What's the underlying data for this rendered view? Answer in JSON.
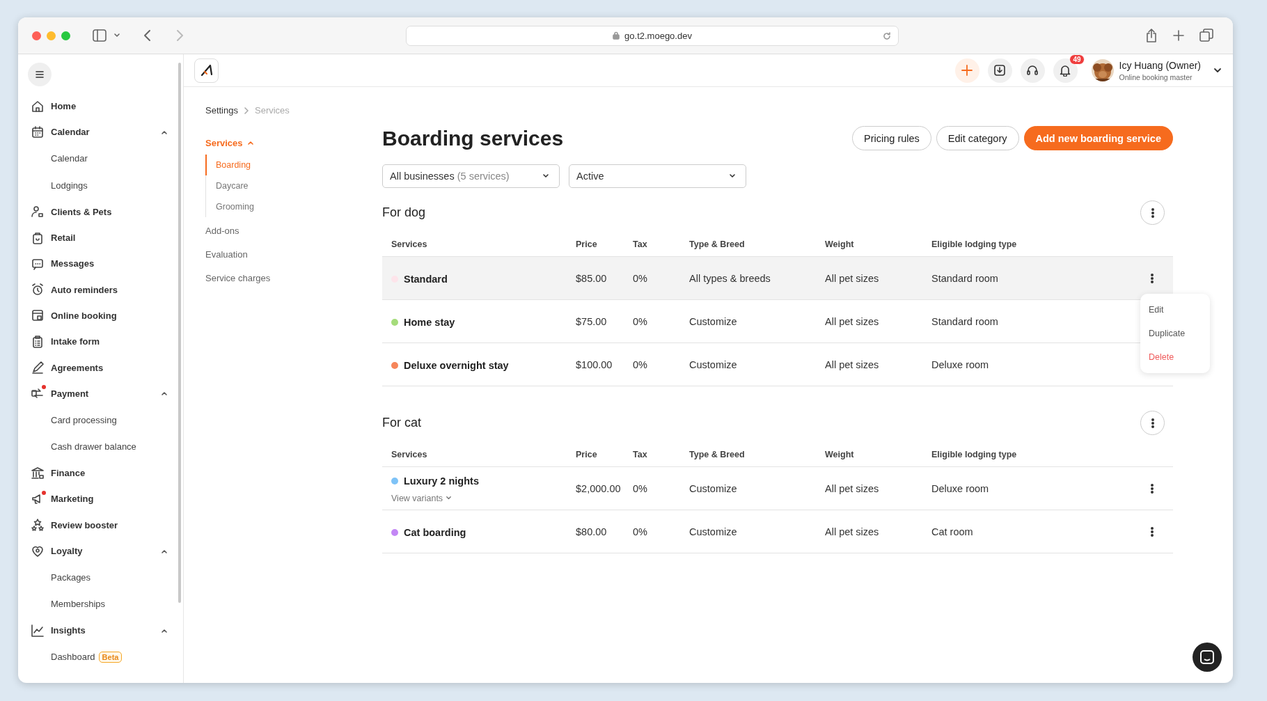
{
  "browser": {
    "url": "go.t2.moego.dev"
  },
  "sidebar": {
    "items": [
      {
        "label": "Home",
        "dot": false
      },
      {
        "label": "Calendar",
        "dot": false,
        "expanded": true,
        "children": [
          {
            "label": "Calendar"
          },
          {
            "label": "Lodgings"
          }
        ]
      },
      {
        "label": "Clients & Pets",
        "dot": false
      },
      {
        "label": "Retail",
        "dot": false
      },
      {
        "label": "Messages",
        "dot": false
      },
      {
        "label": "Auto reminders",
        "dot": false
      },
      {
        "label": "Online booking",
        "dot": false
      },
      {
        "label": "Intake form",
        "dot": false
      },
      {
        "label": "Agreements",
        "dot": false
      },
      {
        "label": "Payment",
        "dot": true,
        "expanded": true,
        "children": [
          {
            "label": "Card processing"
          },
          {
            "label": "Cash drawer balance"
          }
        ]
      },
      {
        "label": "Finance",
        "dot": false
      },
      {
        "label": "Marketing",
        "dot": true
      },
      {
        "label": "Review booster",
        "dot": false
      },
      {
        "label": "Loyalty",
        "dot": false,
        "expanded": true,
        "children": [
          {
            "label": "Packages"
          },
          {
            "label": "Memberships"
          }
        ]
      },
      {
        "label": "Insights",
        "dot": false,
        "expanded": true,
        "children": [
          {
            "label": "Dashboard",
            "badge": "Beta"
          }
        ]
      }
    ]
  },
  "header": {
    "notification_count": "49",
    "user_name": "Icy Huang (Owner)",
    "user_role": "Online booking master"
  },
  "breadcrumb": [
    "Settings",
    "Services"
  ],
  "settings_nav": [
    {
      "label": "Services",
      "selected": true,
      "expanded": true,
      "children": [
        {
          "label": "Boarding",
          "selected": true
        },
        {
          "label": "Daycare",
          "selected": false
        },
        {
          "label": "Grooming",
          "selected": false
        }
      ]
    },
    {
      "label": "Add-ons",
      "selected": false
    },
    {
      "label": "Evaluation",
      "selected": false
    },
    {
      "label": "Service charges",
      "selected": false
    }
  ],
  "page": {
    "title": "Boarding services",
    "buttons": [
      {
        "label": "Pricing rules",
        "kind": "outline"
      },
      {
        "label": "Edit category",
        "kind": "outline"
      },
      {
        "label": "Add new boarding service",
        "kind": "primary"
      }
    ],
    "filters": [
      {
        "value": "All businesses",
        "hint": "(5 services)"
      },
      {
        "value": "Active"
      }
    ]
  },
  "groups": [
    {
      "title": "For dog",
      "columns": [
        "Services",
        "Price",
        "Tax",
        "Type & Breed",
        "Weight",
        "Eligible lodging type"
      ],
      "rows": [
        {
          "name": "Standard",
          "color": "#fde4ea",
          "price": "$85.00",
          "tax": "0%",
          "type": "All types & breeds",
          "weight": "All pet sizes",
          "lodging": "Standard room",
          "highlighted": true,
          "menu": [
            {
              "label": "Edit",
              "kind": "normal"
            },
            {
              "label": "Duplicate",
              "kind": "normal"
            },
            {
              "label": "Delete",
              "kind": "danger"
            }
          ]
        },
        {
          "name": "Home stay",
          "color": "#a5dc7b",
          "price": "$75.00",
          "tax": "0%",
          "type": "Customize",
          "weight": "All pet sizes",
          "lodging": "Standard room",
          "highlighted": false
        },
        {
          "name": "Deluxe overnight stay",
          "color": "#f6855a",
          "price": "$100.00",
          "tax": "0%",
          "type": "Customize",
          "weight": "All pet sizes",
          "lodging": "Deluxe room",
          "highlighted": false
        }
      ]
    },
    {
      "title": "For cat",
      "columns": [
        "Services",
        "Price",
        "Tax",
        "Type & Breed",
        "Weight",
        "Eligible lodging type"
      ],
      "rows": [
        {
          "name": "Luxury 2 nights",
          "color": "#7ec3f7",
          "price": "$2,000.00",
          "tax": "0%",
          "type": "Customize",
          "weight": "All pet sizes",
          "lodging": "Deluxe room",
          "highlighted": false,
          "variants": "View variants"
        },
        {
          "name": "Cat boarding",
          "color": "#c387f5",
          "price": "$80.00",
          "tax": "0%",
          "type": "Customize",
          "weight": "All pet sizes",
          "lodging": "Cat room",
          "highlighted": false
        }
      ]
    }
  ]
}
